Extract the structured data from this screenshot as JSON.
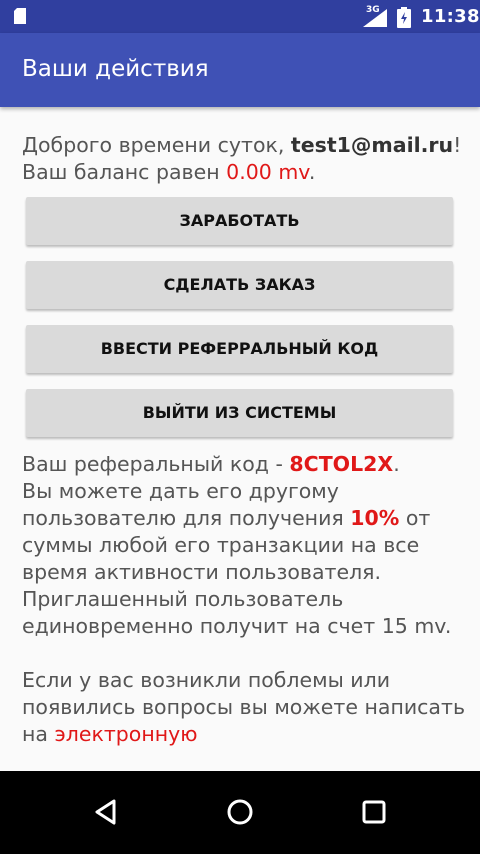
{
  "status_bar": {
    "network_type": "3G",
    "time": "11:38"
  },
  "app_bar": {
    "title": "Ваши действия"
  },
  "greeting": {
    "prefix": "Доброго времени суток, ",
    "email": "test1@mail.ru",
    "suffix": "!",
    "balance_prefix": "Ваш баланс равен ",
    "balance_value": "0.00 mv",
    "balance_suffix": "."
  },
  "buttons": {
    "earn": "ЗАРАБОТАТЬ",
    "order": "СДЕЛАТЬ ЗАКАЗ",
    "enter_referral": "ВВЕСТИ РЕФЕРРАЛЬНЫЙ КОД",
    "logout": "ВЫЙТИ ИЗ СИСТЕМЫ"
  },
  "info": {
    "referral_prefix": "Ваш реферальный код - ",
    "referral_code": "8CTOL2X",
    "referral_suffix": ".",
    "line_give": "Вы можете дать его другому пользователю для получения ",
    "percent": "10%",
    "line_rest": " от суммы любой его транзакции на все время активности пользователя. Приглашенный пользователь единовременно получит на счет 15 mv.",
    "problems_text": "Если у вас возникли поблемы или появились вопросы вы можете написать на ",
    "problems_link": "электронную"
  },
  "colors": {
    "status_bar": "#303f9f",
    "app_bar": "#3f51b5",
    "accent_red": "#e01818"
  }
}
